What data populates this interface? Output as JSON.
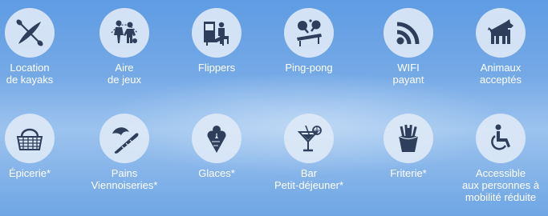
{
  "colors": {
    "icon_fill": "#2f3e5a",
    "circle_bg": "#dce8f6",
    "label": "#ffffff"
  },
  "services": [
    {
      "icon": "kayak-icon",
      "line1": "Location",
      "line2": "de kayaks"
    },
    {
      "icon": "playground-icon",
      "line1": "Aire",
      "line2": "de jeux"
    },
    {
      "icon": "pinball-icon",
      "line1": "Flippers",
      "line2": ""
    },
    {
      "icon": "ping-pong-icon",
      "line1": "Ping-pong",
      "line2": ""
    },
    {
      "icon": "wifi-icon",
      "line1": "WIFI",
      "line2": "payant"
    },
    {
      "icon": "pets-allowed-icon",
      "line1": "Animaux",
      "line2": "acceptés"
    },
    {
      "icon": "grocery-basket-icon",
      "line1": "Épicerie*",
      "line2": ""
    },
    {
      "icon": "bread-croissant-icon",
      "line1": "Pains",
      "line2": "Viennoiseries*"
    },
    {
      "icon": "ice-cream-icon",
      "line1": "Glaces*",
      "line2": ""
    },
    {
      "icon": "cocktail-bar-icon",
      "line1": "Bar",
      "line2": "Petit-déjeuner*"
    },
    {
      "icon": "fries-icon",
      "line1": "Friterie*",
      "line2": ""
    },
    {
      "icon": "wheelchair-icon",
      "line1": "Accessible",
      "line2": "aux personnes à",
      "line3": "mobilité réduite"
    }
  ]
}
